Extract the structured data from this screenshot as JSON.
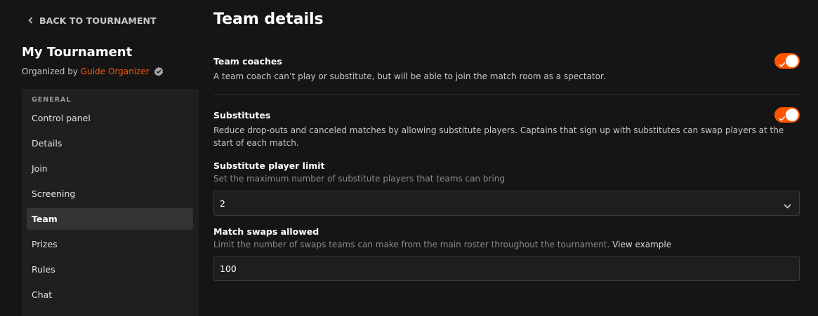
{
  "nav": {
    "back_label": "BACK TO TOURNAMENT",
    "tournament_title": "My Tournament",
    "organized_by": "Organized by",
    "organizer_name": "Guide Organizer",
    "section_label": "GENERAL",
    "items": [
      {
        "label": "Control panel"
      },
      {
        "label": "Details"
      },
      {
        "label": "Join"
      },
      {
        "label": "Screening"
      },
      {
        "label": "Team",
        "active": true
      },
      {
        "label": "Prizes"
      },
      {
        "label": "Rules"
      },
      {
        "label": "Chat"
      }
    ]
  },
  "main": {
    "title": "Team details",
    "coaches": {
      "title": "Team coaches",
      "description": "A team coach can’t play or substitute, but will be able to join the match room as a spectator.",
      "enabled": true
    },
    "substitutes": {
      "title": "Substitutes",
      "description": "Reduce drop-outs and canceled matches by allowing substitute players. Captains that sign up with substitutes can swap players at the start of each match.",
      "enabled": true
    },
    "substitute_limit": {
      "label": "Substitute player limit",
      "help": "Set the maximum number of substitute players that teams can bring",
      "value": "2"
    },
    "match_swaps": {
      "label": "Match swaps allowed",
      "help": "Limit the number of swaps teams can make from the main roster throughout the tournament.",
      "link": "View example",
      "value": "100"
    }
  },
  "colors": {
    "accent": "#ff5500",
    "background": "#151515",
    "sidebar": "#1f1f1f"
  }
}
